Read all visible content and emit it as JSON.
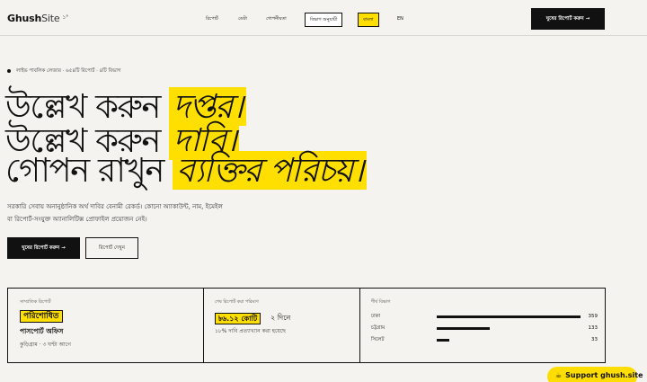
{
  "header": {
    "logo_main": "Ghush",
    "logo_site": "Site",
    "logo_sup": "১°",
    "nav": [
      "রিপোর্ট",
      "ডেটা",
      "গোপনীয়তা"
    ],
    "nav_boxed": "বিভাগ অনুযায়ী",
    "nav_yellow": "বাংলা",
    "nav_lang": "EN",
    "cta": "ঘুষের রিপোর্ট করুন →"
  },
  "meta": {
    "line": "লাইভ পাবলিক লেজার · ৬৫৪টি রিপোর্ট · ৪টি বিভাগ"
  },
  "hero": {
    "line1": "উল্লেখ করুন",
    "line1_highlight": "দপ্তর।",
    "line2": "উল্লেখ করুন",
    "line2_highlight": "দাবি।",
    "line3": "গোপন রাখুন",
    "line3_highlight": "ব্যক্তির পরিচয়।"
  },
  "description": {
    "line1": "সরকারি সেবায় অনানুষ্ঠানিক অর্থ দাবির বেনামী রেকর্ড। কোনো অ্যাকাউন্ট, নাম, ইমেইল",
    "line2": "বা রিপোর্ট-সংযুক্ত অ্যানালিটিক্স প্রোফাইল প্রয়োজন নেই।"
  },
  "buttons": {
    "primary": "ঘুষের রিপোর্ট করুন →",
    "secondary": "রিপোর্ট দেখুন"
  },
  "stats": {
    "recent": {
      "label": "সাম্প্রতিক রিপোর্ট",
      "badge": "পরিশোধিত",
      "office": "পাসপোর্ট অফিস",
      "location": "কুড়িগ্রাম · ৩ ঘণ্টা আগে"
    },
    "median": {
      "label": "শেষ রিপোর্ট করা পরিমাণ",
      "badge": "৳৬.১২ কোটি",
      "days": "২ দিনে",
      "note": "১৮% দাবি প্রত্যাখ্যান করা হয়েছে"
    },
    "divisions": {
      "label": "শীর্ষ বিভাগ",
      "rows": [
        {
          "name": "ঢাকা",
          "value": 359,
          "fraction": 1.0
        },
        {
          "name": "চট্টগ্রাম",
          "value": 133,
          "fraction": 0.37
        },
        {
          "name": "সিলেট",
          "value": 33,
          "fraction": 0.09
        }
      ]
    }
  },
  "support": {
    "label": "Support ghush.site"
  }
}
